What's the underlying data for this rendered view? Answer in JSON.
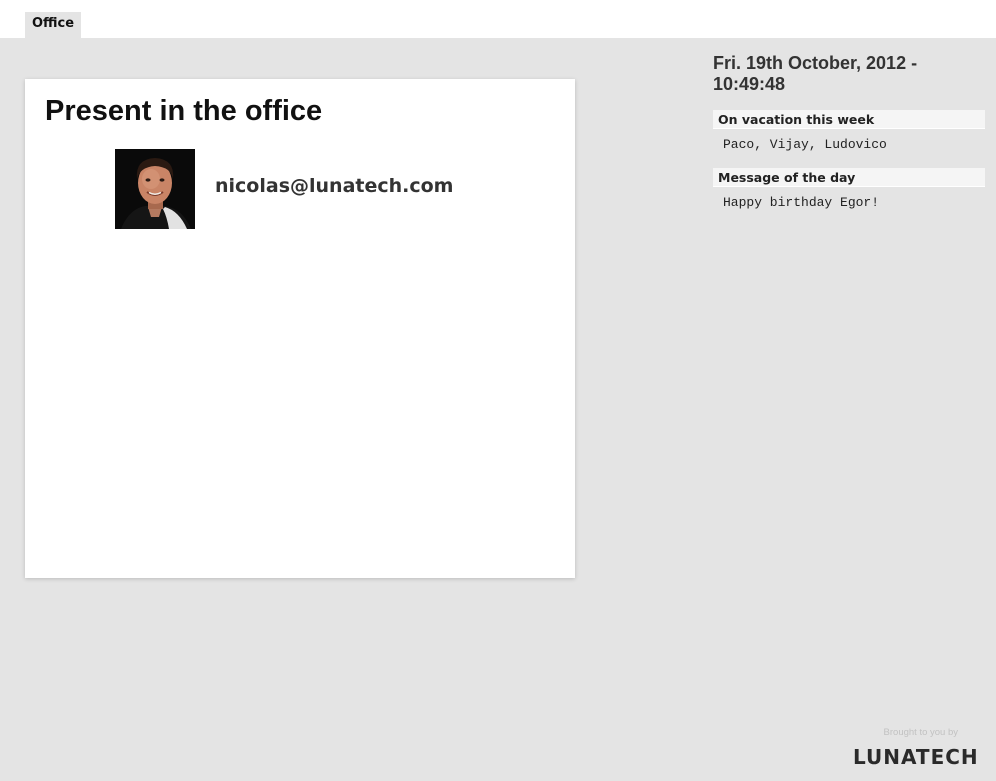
{
  "tabs": [
    {
      "label": "Office",
      "active": true
    }
  ],
  "main": {
    "title": "Present in the office",
    "people": [
      {
        "email": "nicolas@lunatech.com",
        "avatar_icon": "person-photo"
      }
    ]
  },
  "sidebar": {
    "datetime": "Fri. 19th October, 2012 - 10:49:48",
    "vacation": {
      "title": "On vacation this week",
      "text": "Paco, Vijay, Ludovico"
    },
    "message": {
      "title": "Message of the day",
      "text": "Happy birthday Egor!"
    }
  },
  "footer": {
    "brought_by": "Brought to you by",
    "logo_text": "LUNATECH"
  },
  "colors": {
    "background": "#e4e4e4",
    "panel": "#ffffff",
    "header_bg": "#f5f5f5",
    "text": "#222222"
  }
}
